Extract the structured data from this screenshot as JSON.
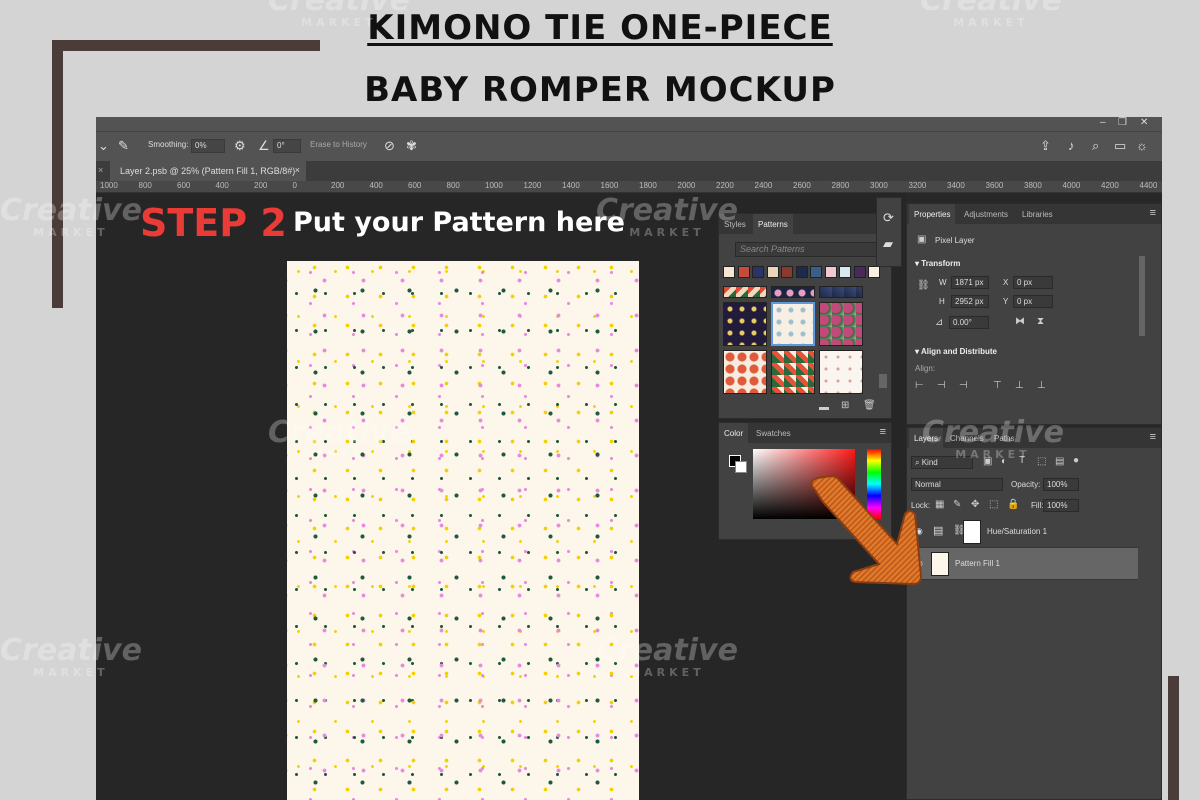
{
  "title": {
    "line1": "KIMONO TIE ONE-PIECE",
    "line2": "BABY ROMPER MOCKUP"
  },
  "watermark": {
    "brand": "Creative",
    "sub": "MARKET"
  },
  "step": {
    "label": "STEP 2",
    "text": "Put your Pattern here"
  },
  "window_controls": {
    "minimize": "–",
    "restore": "❐",
    "close": "✕"
  },
  "options_bar": {
    "smoothing_label": "Smoothing:",
    "smoothing_value": "0%",
    "angle_value": "0°",
    "erase_to_history": "Erase to History"
  },
  "document_tab": {
    "close": "×",
    "label": "Layer 2.psb @ 25% (Pattern Fill 1, RGB/8#)"
  },
  "ruler_ticks": [
    "1000",
    "800",
    "600",
    "400",
    "200",
    "0",
    "200",
    "400",
    "600",
    "800",
    "1000",
    "1200",
    "1400",
    "1600",
    "1800",
    "2000",
    "2200",
    "2400",
    "2600",
    "2800",
    "3000",
    "3200",
    "3400",
    "3600",
    "3800",
    "4000",
    "4200",
    "4400"
  ],
  "patterns_panel": {
    "tabs": [
      "Styles",
      "Patterns"
    ],
    "active_tab": "Patterns",
    "search_placeholder": "Search Patterns"
  },
  "color_panel": {
    "tabs": [
      "Color",
      "Swatches"
    ],
    "active_tab": "Color"
  },
  "properties_panel": {
    "tabs": [
      "Properties",
      "Adjustments",
      "Libraries"
    ],
    "active_tab": "Properties",
    "layer_type": "Pixel Layer",
    "transform_label": "Transform",
    "w_label": "W",
    "w_value": "1871 px",
    "h_label": "H",
    "h_value": "2952 px",
    "x_label": "X",
    "x_value": "0 px",
    "y_label": "Y",
    "y_value": "0 px",
    "angle_value": "0.00°",
    "align_section": "Align and Distribute",
    "align_label": "Align:"
  },
  "layers_panel": {
    "tabs": [
      "Layers",
      "Channels",
      "Paths"
    ],
    "active_tab": "Layers",
    "filter_kind": "Kind",
    "blend_mode": "Normal",
    "opacity_label": "Opacity:",
    "opacity_value": "100%",
    "lock_label": "Lock:",
    "fill_label": "Fill:",
    "fill_value": "100%",
    "layers": [
      {
        "name": "Hue/Saturation 1",
        "selected": false
      },
      {
        "name": "Pattern Fill 1",
        "selected": true
      }
    ]
  },
  "colors": {
    "accent_red": "#ea3b36",
    "frame": "#4a3c38",
    "arrow_orange": "#e07a2a"
  }
}
